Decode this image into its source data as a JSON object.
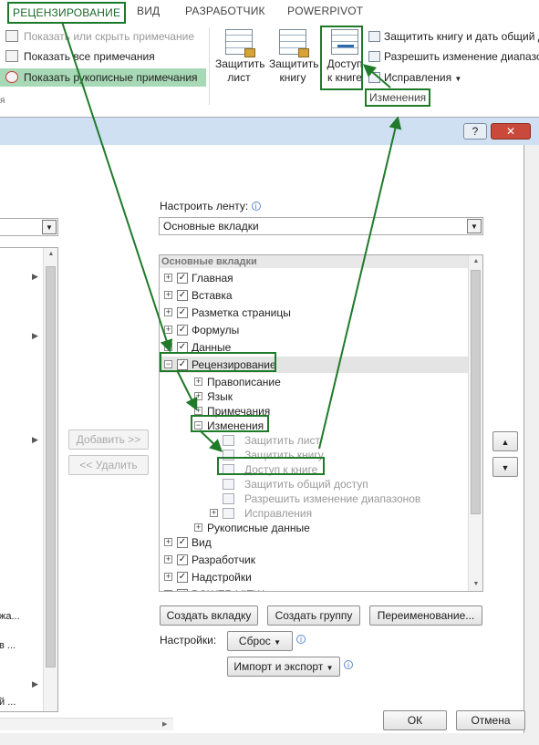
{
  "ribbon": {
    "tabs": [
      "РЕЦЕНЗИРОВАНИЕ",
      "ВИД",
      "РАЗРАБОТЧИК",
      "POWERPIVOT"
    ],
    "comments": {
      "toggle": "Показать или скрыть примечание",
      "show_all": "Показать все примечания",
      "show_ink": "Показать рукописные примечания"
    },
    "protect_sheet": [
      "Защитить",
      "лист"
    ],
    "protect_book": [
      "Защитить",
      "книгу"
    ],
    "share_book": [
      "Доступ",
      "к книге"
    ],
    "protect_share": "Защитить книгу и дать общий д",
    "allow_ranges": "Разрешить изменение диапазо",
    "track_changes": "Исправления",
    "group_label": "Изменения"
  },
  "dialog": {
    "help": "?",
    "close": "✕",
    "customize_label": "Настроить ленту:",
    "customize_value": "Основные вкладки",
    "tree_header": "Основные вкладки",
    "tree": [
      {
        "label": "Главная",
        "checked": true,
        "expanded": false
      },
      {
        "label": "Вставка",
        "checked": true,
        "expanded": false
      },
      {
        "label": "Разметка страницы",
        "checked": true,
        "expanded": false
      },
      {
        "label": "Формулы",
        "checked": true,
        "expanded": false
      },
      {
        "label": "Данные",
        "checked": true,
        "expanded": false
      },
      {
        "label": "Рецензирование",
        "checked": true,
        "expanded": true
      },
      {
        "label": "Правописание",
        "level": 1
      },
      {
        "label": "Язык",
        "level": 1
      },
      {
        "label": "Примечания",
        "level": 1
      },
      {
        "label": "Изменения",
        "level": 1,
        "expanded": true
      },
      {
        "label": "Защитить лист",
        "level": 2
      },
      {
        "label": "Защитить книгу",
        "level": 2
      },
      {
        "label": "Доступ к книге",
        "level": 2
      },
      {
        "label": "Защитить общий доступ",
        "level": 2
      },
      {
        "label": "Разрешить изменение диапазонов",
        "level": 2
      },
      {
        "label": "Исправления",
        "level": 2
      },
      {
        "label": "Рукописные данные",
        "level": 1
      },
      {
        "label": "Вид",
        "checked": true,
        "expanded": false
      },
      {
        "label": "Разработчик",
        "checked": true,
        "expanded": false
      },
      {
        "label": "Надстройки",
        "checked": true,
        "expanded": false
      },
      {
        "label": "POWER VIEW",
        "checked": true,
        "expanded": false
      }
    ],
    "left_fragments": [
      "жа...",
      "в ...",
      "й ..."
    ],
    "add": "Добавить >>",
    "remove": "<< Удалить",
    "new_tab": "Создать вкладку",
    "new_group": "Создать группу",
    "rename": "Переименование...",
    "settings_label": "Настройки:",
    "reset": "Сброс",
    "import_export": "Импорт и экспорт",
    "ok": "ОК",
    "cancel": "Отмена"
  },
  "colors": {
    "highlight": "#1f7a2a",
    "titlebar": "#cfe0f3"
  }
}
